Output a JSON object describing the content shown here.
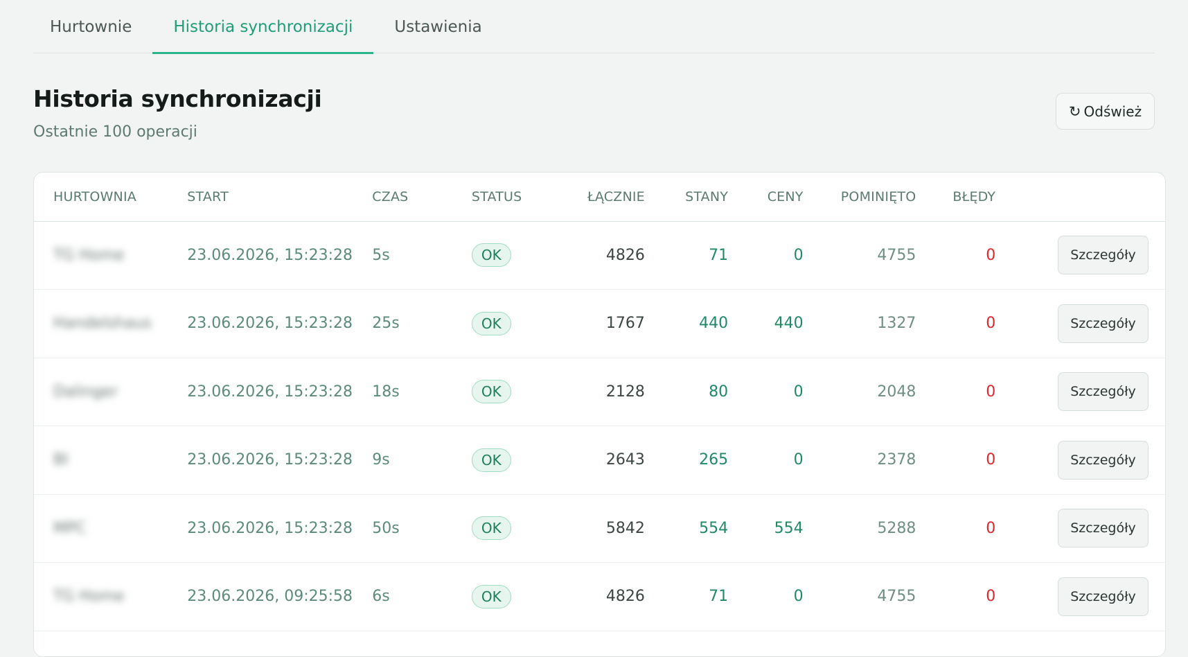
{
  "tabs": [
    {
      "label": "Hurtownie",
      "active": false
    },
    {
      "label": "Historia synchronizacji",
      "active": true
    },
    {
      "label": "Ustawienia",
      "active": false
    }
  ],
  "header": {
    "title": "Historia synchronizacji",
    "subtitle": "Ostatnie 100 operacji",
    "refresh_label": "Odśwież",
    "refresh_icon": "↻"
  },
  "table": {
    "columns": {
      "wholesaler": "HURTOWNIA",
      "start": "START",
      "time": "CZAS",
      "status": "STATUS",
      "total": "ŁĄCZNIE",
      "stock": "STANY",
      "prices": "CENY",
      "skipped": "POMINIĘTO",
      "errors": "BŁĘDY"
    },
    "details_label": "Szczegóły",
    "rows": [
      {
        "wholesaler": "TG Home",
        "start": "23.06.2026, 15:23:28",
        "time": "5s",
        "status": "OK",
        "total": "4826",
        "stock": "71",
        "prices": "0",
        "skipped": "4755",
        "errors": "0"
      },
      {
        "wholesaler": "Handelshaus",
        "start": "23.06.2026, 15:23:28",
        "time": "25s",
        "status": "OK",
        "total": "1767",
        "stock": "440",
        "prices": "440",
        "skipped": "1327",
        "errors": "0"
      },
      {
        "wholesaler": "Dalinger",
        "start": "23.06.2026, 15:23:28",
        "time": "18s",
        "status": "OK",
        "total": "2128",
        "stock": "80",
        "prices": "0",
        "skipped": "2048",
        "errors": "0"
      },
      {
        "wholesaler": "BI",
        "start": "23.06.2026, 15:23:28",
        "time": "9s",
        "status": "OK",
        "total": "2643",
        "stock": "265",
        "prices": "0",
        "skipped": "2378",
        "errors": "0"
      },
      {
        "wholesaler": "MPC",
        "start": "23.06.2026, 15:23:28",
        "time": "50s",
        "status": "OK",
        "total": "5842",
        "stock": "554",
        "prices": "554",
        "skipped": "5288",
        "errors": "0"
      },
      {
        "wholesaler": "TG Home",
        "start": "23.06.2026, 09:25:58",
        "time": "6s",
        "status": "OK",
        "total": "4826",
        "stock": "71",
        "prices": "0",
        "skipped": "4755",
        "errors": "0"
      }
    ]
  }
}
